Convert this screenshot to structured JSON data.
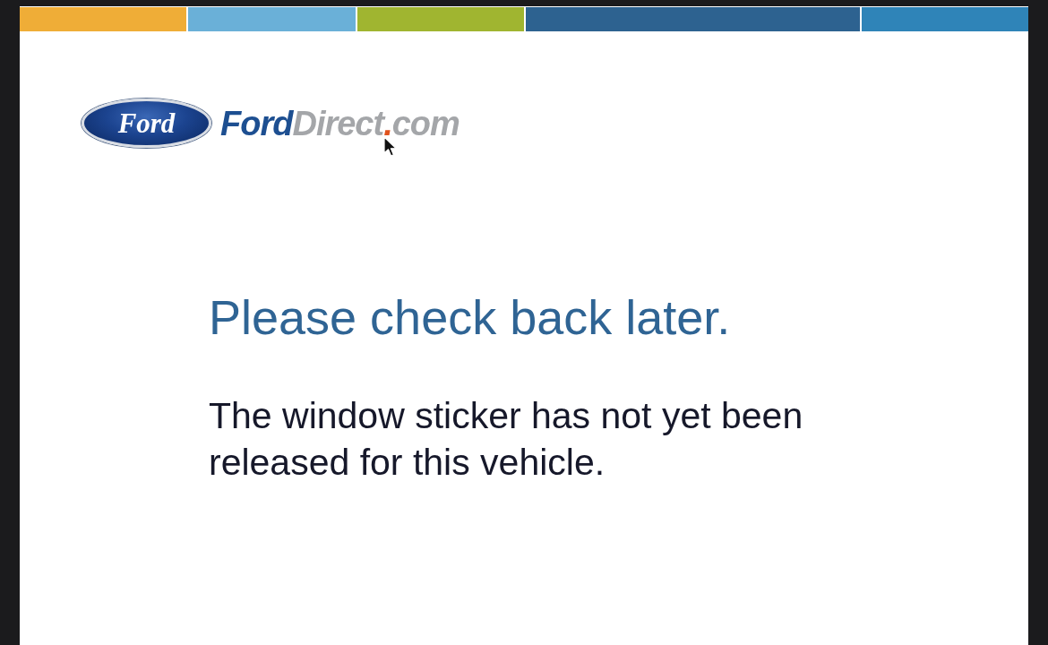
{
  "color_bar": [
    {
      "color": "#efad37",
      "kind": "narrow"
    },
    {
      "color": "#6ab0d8",
      "kind": "narrow"
    },
    {
      "color": "#a0b530",
      "kind": "narrow"
    },
    {
      "color": "#2d6290",
      "kind": "wide"
    },
    {
      "color": "#2f84b8",
      "kind": "narrow"
    }
  ],
  "logo": {
    "emblem_text": "Ford",
    "wordmark": [
      {
        "text": "Ford",
        "kind": "brand"
      },
      {
        "text": "Direct",
        "kind": "plain"
      },
      {
        "text": ".",
        "kind": "accent"
      },
      {
        "text": "com",
        "kind": "plain"
      }
    ]
  },
  "message": {
    "heading": "Please check back later.",
    "body": "The window sticker has not yet been released for this vehicle."
  }
}
